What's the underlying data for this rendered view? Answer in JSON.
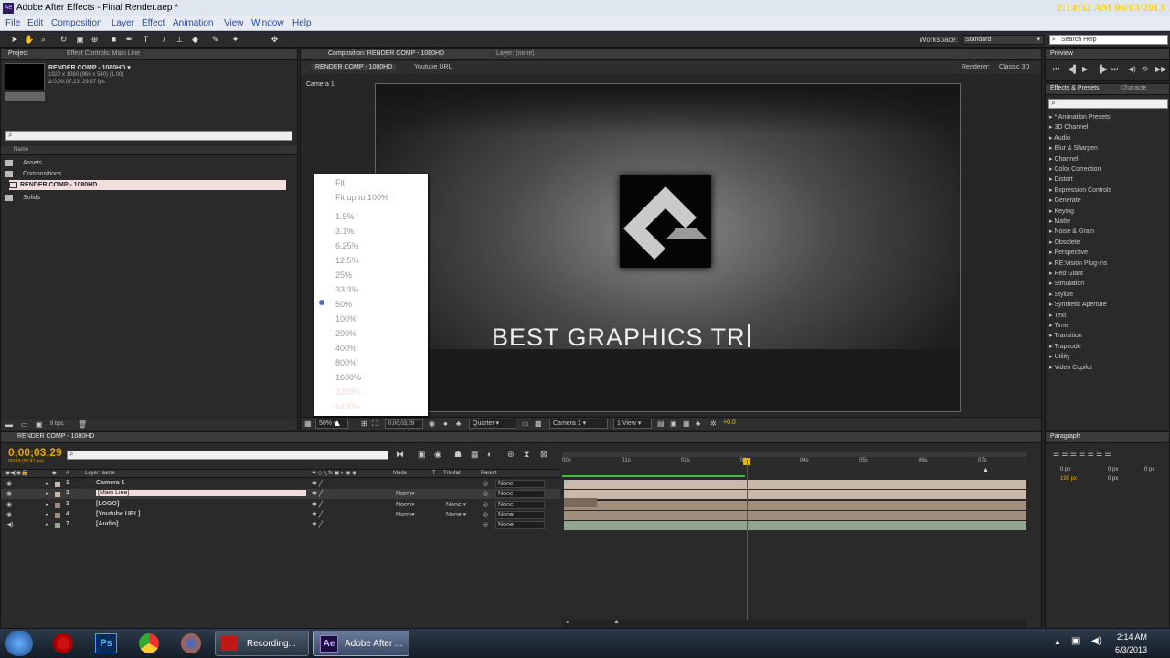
{
  "window": {
    "title": "Adobe After Effects - Final Render.aep *",
    "clock": "2:14:52 AM 06/03/2013"
  },
  "menu": [
    "File",
    "Edit",
    "Composition",
    "Layer",
    "Effect",
    "Animation",
    "View",
    "Window",
    "Help"
  ],
  "toolbar": {
    "workspace_label": "Workspace:",
    "workspace_value": "Standard",
    "search_placeholder": "Search Help"
  },
  "project": {
    "tab": "Project",
    "tab2": "Effect Controls: Main Line",
    "comp_name": "RENDER COMP - 1080HD ▾",
    "comp_size": "1920 x 1080  (960 x 540) (1.00)",
    "comp_dur": "Δ 0;00;07;23, 29.97 fps",
    "col_name": "Name",
    "items": [
      "Assets",
      "Compositions",
      "RENDER COMP - 1080HD",
      "Solids"
    ],
    "bpc": "8 bpc"
  },
  "comp": {
    "tab": "Composition: RENDER COMP - 1080HD",
    "layer_tab": "Layer: (none)",
    "subtabs": [
      "RENDER COMP - 1080HD",
      "Youtube URL"
    ],
    "renderer_label": "Renderer:",
    "renderer": "Classic 3D",
    "camera_label": "Camera 1",
    "preview_text": "BEST GRAPHICS TR",
    "footer": {
      "zoom": "50%",
      "time": "0;00;03;29",
      "res": "Quarter",
      "camera": "Camera 1",
      "views": "1 View",
      "exposure": "+0.0"
    }
  },
  "zoom_menu": [
    "Fit",
    "Fit up to 100%",
    "1.5%",
    "3.1%",
    "6.25%",
    "12.5%",
    "25%",
    "33.3%",
    "50%",
    "100%",
    "200%",
    "400%",
    "800%",
    "1600%",
    "3200%",
    "6400%"
  ],
  "preview": {
    "tab": "Preview"
  },
  "effects": {
    "tab": "Effects & Presets",
    "tab2": "Characte",
    "items": [
      "* Animation Presets",
      "3D Channel",
      "Audio",
      "Blur & Sharpen",
      "Channel",
      "Color Correction",
      "Distort",
      "Expression Controls",
      "Generate",
      "Keying",
      "Matte",
      "Noise & Grain",
      "Obsolete",
      "Perspective",
      "RE:Vision Plug-ins",
      "Red Giant",
      "Simulation",
      "Stylize",
      "Synthetic Aperture",
      "Text",
      "Time",
      "Transition",
      "Trapcode",
      "Utility",
      "Video Copilot"
    ]
  },
  "paragraph": {
    "tab": "Paragraph",
    "v1": "0 px",
    "v2": "0 px",
    "v3": "0 px",
    "v4": "199 px",
    "v5": "0 px"
  },
  "timeline": {
    "tab": "RENDER COMP - 1080HD",
    "timecode": "0;00;03;29",
    "fps": "00119 (29.97 fps)",
    "cols": {
      "num": "#",
      "name": "Layer Name",
      "mode": "Mode",
      "t": "T",
      "trkmat": "TrkMat",
      "parent": "Parent"
    },
    "ticks": [
      "00s",
      "01s",
      "02s",
      "03s",
      "04s",
      "05s",
      "06s",
      "07s"
    ],
    "layers": [
      {
        "num": "1",
        "name": "Camera 1",
        "mode": "",
        "trk": "",
        "parent": "None",
        "color": "#c9b9ab"
      },
      {
        "num": "2",
        "name": "[Main Line]",
        "mode": "Norm▾",
        "trk": "",
        "parent": "None",
        "color": "#c9b9ab"
      },
      {
        "num": "3",
        "name": "[LOGO]",
        "mode": "Norm▾",
        "trk": "None ▾",
        "parent": "None",
        "color": "#a08e7c"
      },
      {
        "num": "4",
        "name": "[Youtube URL]",
        "mode": "Norm▾",
        "trk": "None ▾",
        "parent": "None",
        "color": "#a08e7c"
      },
      {
        "num": "7",
        "name": "[Audio]",
        "mode": "",
        "trk": "",
        "parent": "None",
        "color": "#93a48f"
      }
    ]
  },
  "taskbar": {
    "apps": [
      "Recording...",
      "Adobe After ..."
    ],
    "time": "2:14 AM",
    "date": "6/3/2013"
  }
}
